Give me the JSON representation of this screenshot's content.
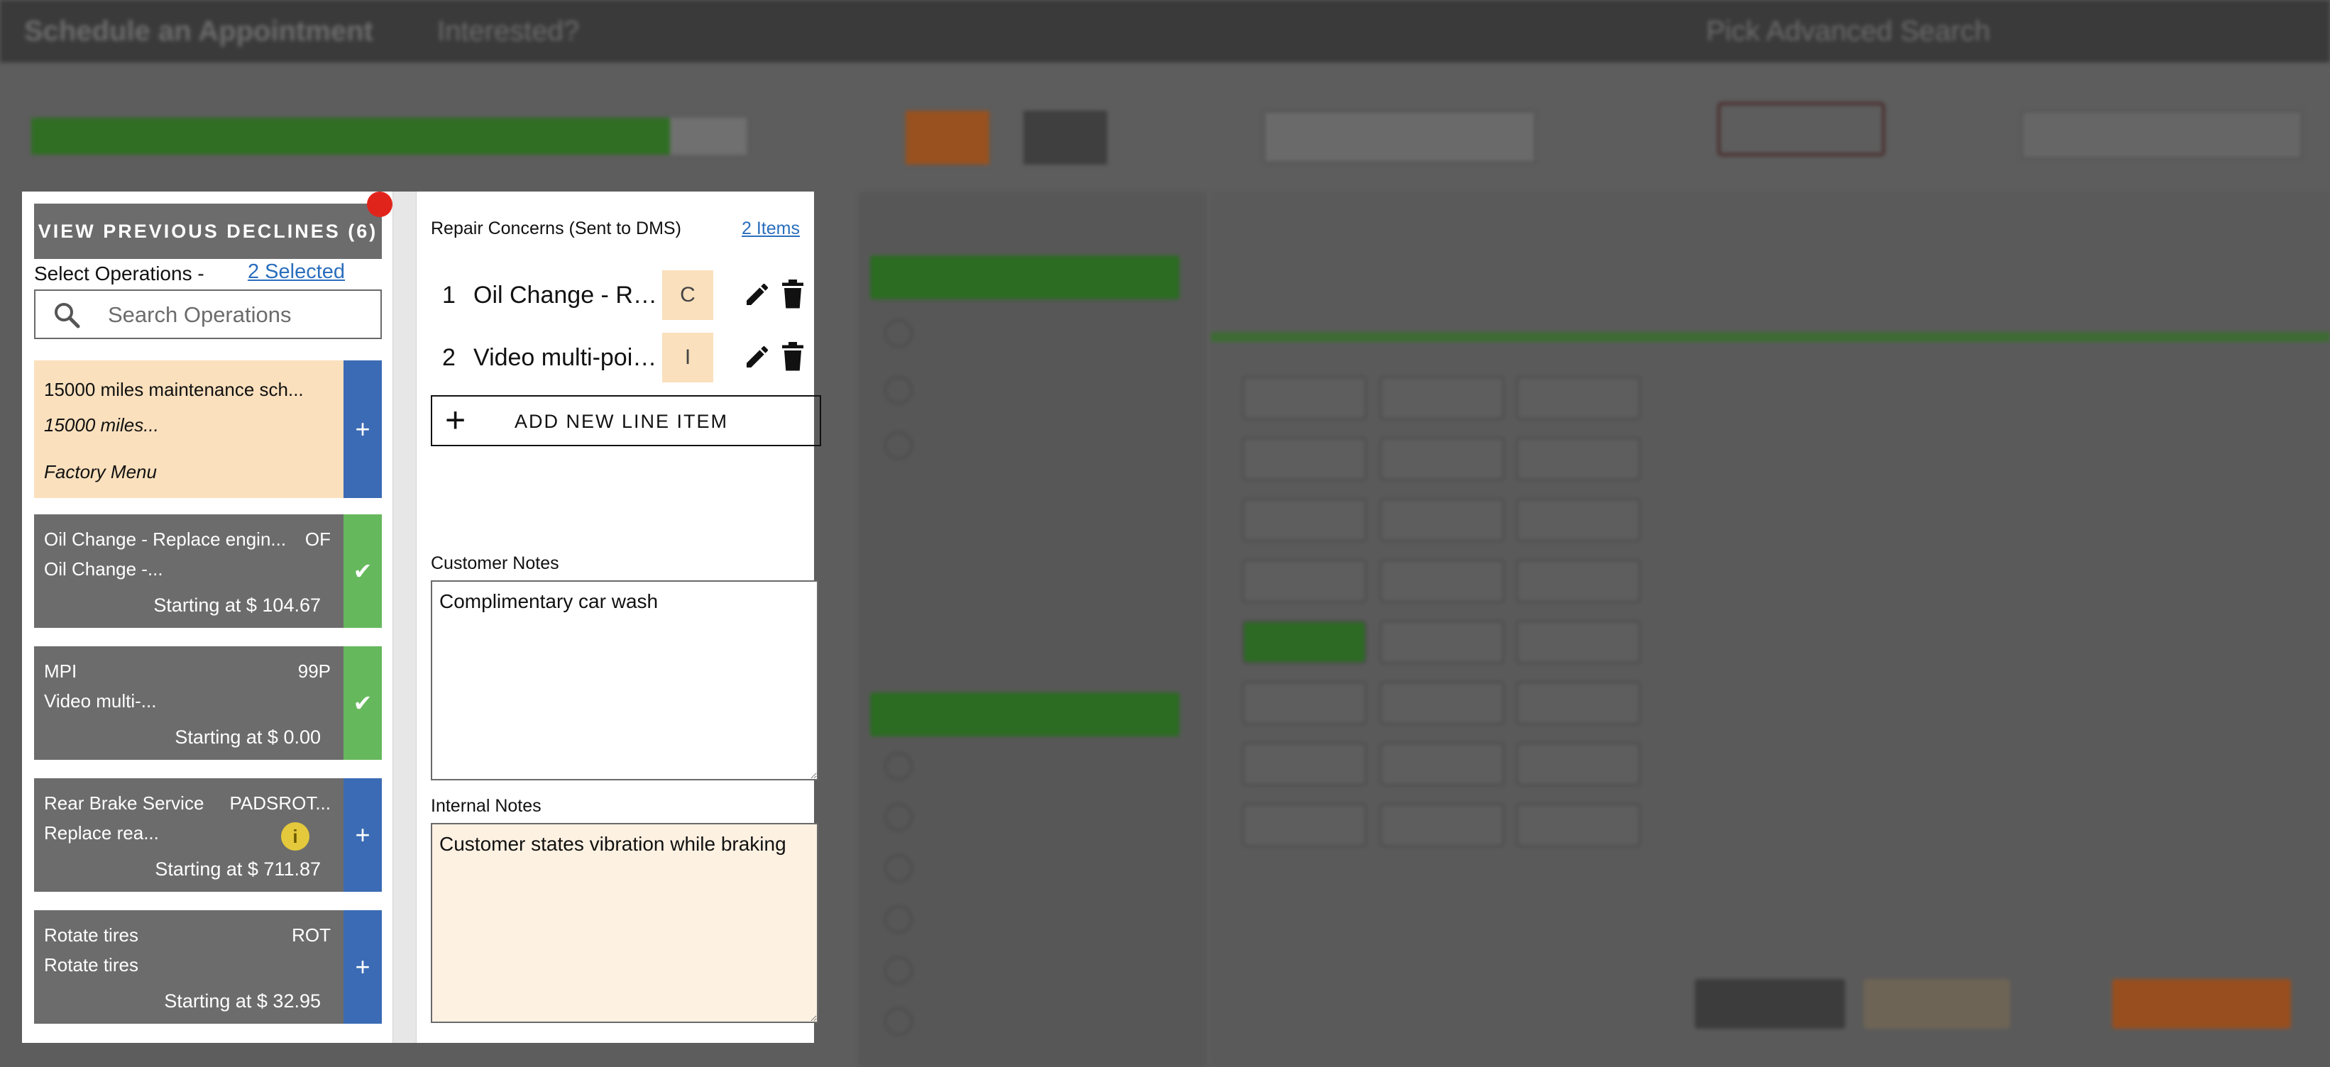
{
  "background": {
    "title": "Schedule an Appointment",
    "subtitle": "Interested?",
    "right_title": "Pick Advanced Search"
  },
  "declines_button": {
    "label": "VIEW PREVIOUS DECLINES (6)"
  },
  "select_operations": {
    "label": "Select Operations -",
    "selected_link": "2 Selected"
  },
  "search": {
    "placeholder": "Search Operations"
  },
  "operations": [
    {
      "title": "15000 miles maintenance sch...",
      "subtitle": "15000 miles...",
      "source": "Factory Menu",
      "state": "pending",
      "action": "+"
    },
    {
      "title": "Oil Change - Replace engin...",
      "code": "OF",
      "subtitle": "Oil Change -...",
      "price": "Starting at $ 104.67",
      "state": "selected",
      "action": "✔"
    },
    {
      "title": "MPI",
      "code": "99P",
      "subtitle": "Video multi-...",
      "price": "Starting at $ 0.00",
      "state": "selected",
      "action": "✔"
    },
    {
      "title": "Rear Brake Service",
      "code": "PADSROT...",
      "subtitle": "Replace rea...",
      "info": "i",
      "price": "Starting at $ 711.87",
      "state": "available",
      "action": "+"
    },
    {
      "title": "Rotate tires",
      "code": "ROT",
      "subtitle": "Rotate tires",
      "price": "Starting at $ 32.95",
      "state": "available",
      "action": "+"
    }
  ],
  "repair_concerns": {
    "title": "Repair Concerns (Sent to DMS)",
    "count_link": "2 Items",
    "lines": [
      {
        "num": "1",
        "desc": "Oil Change - Replace engine oil",
        "type": "C"
      },
      {
        "num": "2",
        "desc": "Video multi-point inspection",
        "type": "I"
      }
    ],
    "add_label": "ADD NEW LINE ITEM",
    "add_icon": "+"
  },
  "customer_notes": {
    "label": "Customer Notes",
    "value": "Complimentary car wash"
  },
  "internal_notes": {
    "label": "Internal Notes",
    "value": "Customer states vibration while braking"
  },
  "colors": {
    "pending_bg": "#fae0bd",
    "selected_side": "#66b85d",
    "add_side": "#3b6bb4",
    "badge_red": "#e0241c",
    "link": "#2a6ebd"
  }
}
